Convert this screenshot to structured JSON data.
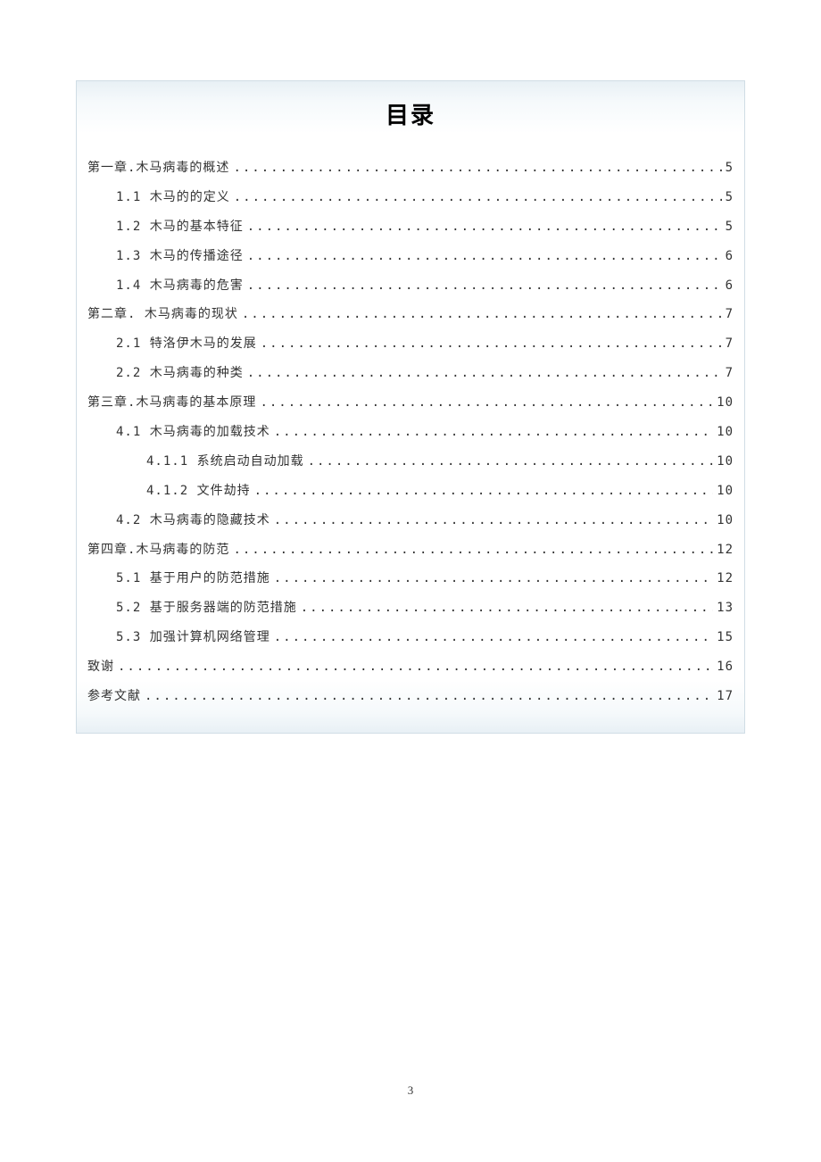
{
  "title": "目录",
  "page_number": "3",
  "toc": [
    {
      "level": 0,
      "label": "第一章.木马病毒的概述",
      "page": "5"
    },
    {
      "level": 1,
      "label": "1.1 木马的的定义",
      "page": "5"
    },
    {
      "level": 1,
      "label": "1.2 木马的基本特征",
      "page": "5"
    },
    {
      "level": 1,
      "label": "1.3 木马的传播途径",
      "page": "6"
    },
    {
      "level": 1,
      "label": "1.4 木马病毒的危害",
      "page": "6"
    },
    {
      "level": 0,
      "label": "第二章.  木马病毒的现状",
      "page": "7"
    },
    {
      "level": 1,
      "label": "2.1 特洛伊木马的发展",
      "page": "7"
    },
    {
      "level": 1,
      "label": "2.2  木马病毒的种类",
      "page": "7"
    },
    {
      "level": 0,
      "label": "第三章.木马病毒的基本原理",
      "page": "10"
    },
    {
      "level": 1,
      "label": "4.1 木马病毒的加载技术",
      "page": "10"
    },
    {
      "level": 2,
      "label": "4.1.1  系统启动自动加载",
      "page": "10"
    },
    {
      "level": 2,
      "label": "4.1.2  文件劫持",
      "page": "10"
    },
    {
      "level": 1,
      "label": "4.2  木马病毒的隐藏技术",
      "page": "10"
    },
    {
      "level": 0,
      "label": "第四章.木马病毒的防范",
      "page": "12"
    },
    {
      "level": 1,
      "label": "5.1 基于用户的防范措施",
      "page": "12"
    },
    {
      "level": 1,
      "label": "5.2 基于服务器端的防范措施",
      "page": "13"
    },
    {
      "level": 1,
      "label": "5.3 加强计算机网络管理",
      "page": "15"
    },
    {
      "level": 0,
      "label": "致谢",
      "page": "16"
    },
    {
      "level": 0,
      "label": "参考文献",
      "page": "17"
    }
  ]
}
